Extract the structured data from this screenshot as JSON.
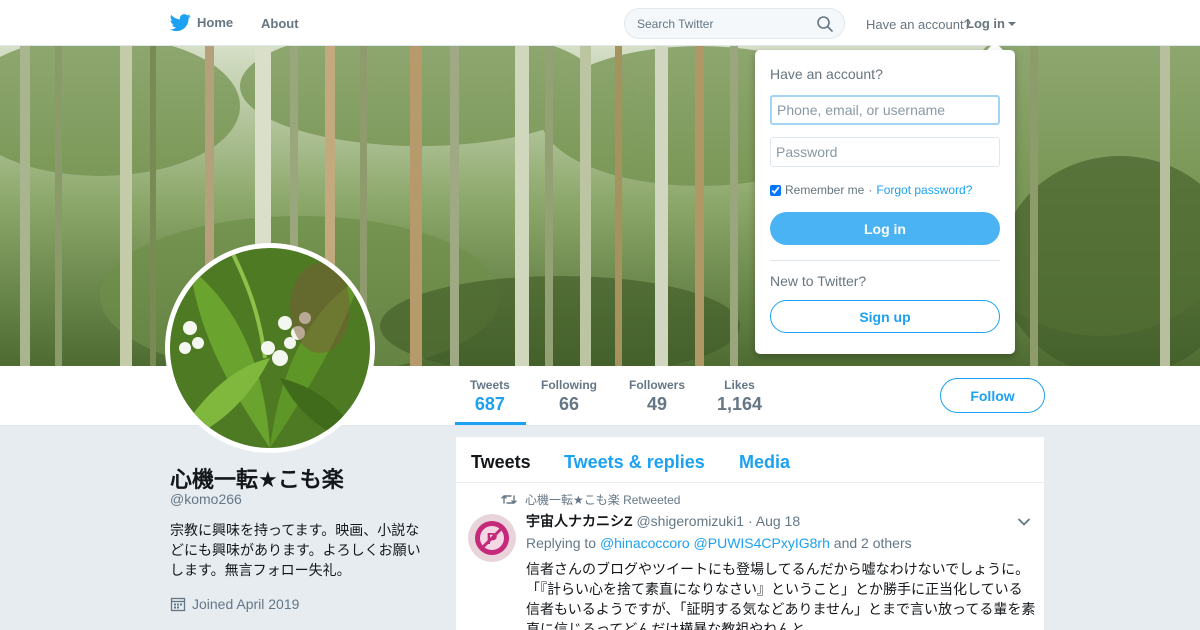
{
  "nav": {
    "home": "Home",
    "about": "About",
    "search_placeholder": "Search Twitter",
    "have_account": "Have an account?",
    "login": "Log in"
  },
  "login_dropdown": {
    "title": "Have an account?",
    "username_placeholder": "Phone, email, or username",
    "password_placeholder": "Password",
    "remember_me": "Remember me",
    "separator": "·",
    "forgot_password": "Forgot password?",
    "login_button": "Log in",
    "new_to_twitter": "New to Twitter?",
    "signup_button": "Sign up"
  },
  "stats": [
    {
      "label": "Tweets",
      "value": "687",
      "active": true
    },
    {
      "label": "Following",
      "value": "66",
      "active": false
    },
    {
      "label": "Followers",
      "value": "49",
      "active": false
    },
    {
      "label": "Likes",
      "value": "1,164",
      "active": false
    }
  ],
  "follow_button": "Follow",
  "profile": {
    "name": "心機一転★こも楽",
    "handle": "@komo266",
    "bio": "宗教に興味を持ってます。映画、小説などにも興味があります。よろしくお願いします。無言フォロー失礼。",
    "joined": "Joined April 2019"
  },
  "timeline": {
    "tabs": [
      {
        "label": "Tweets",
        "active": true
      },
      {
        "label": "Tweets & replies",
        "active": false
      },
      {
        "label": "Media",
        "active": false
      }
    ],
    "tweet": {
      "retweeted_by": "心機一転★こも楽 Retweeted",
      "author_name": "宇宙人ナカニシZ",
      "author_handle": "@shigeromizuki1",
      "separator": "·",
      "date": "Aug 18",
      "replying_to_label": "Replying to",
      "replying_to_1": "@hinacoccoro",
      "replying_to_2": "@PUWIS4CPxyIG8rh",
      "replying_to_more": "and 2 others",
      "text": "信者さんのブログやツイートにも登場してるんだから嘘なわけないでしょうに。「『計らい心を捨て素直になりなさい』ということ」とか勝手に正当化している信者もいるようですが、「証明する気などありません」とまで言い放ってる輩を素直に信じろってどんだけ横暴な教祖やねんと"
    }
  },
  "colors": {
    "accent": "#1da1f2",
    "login_button": "#4ab3f4",
    "background": "#e6ecf0"
  }
}
